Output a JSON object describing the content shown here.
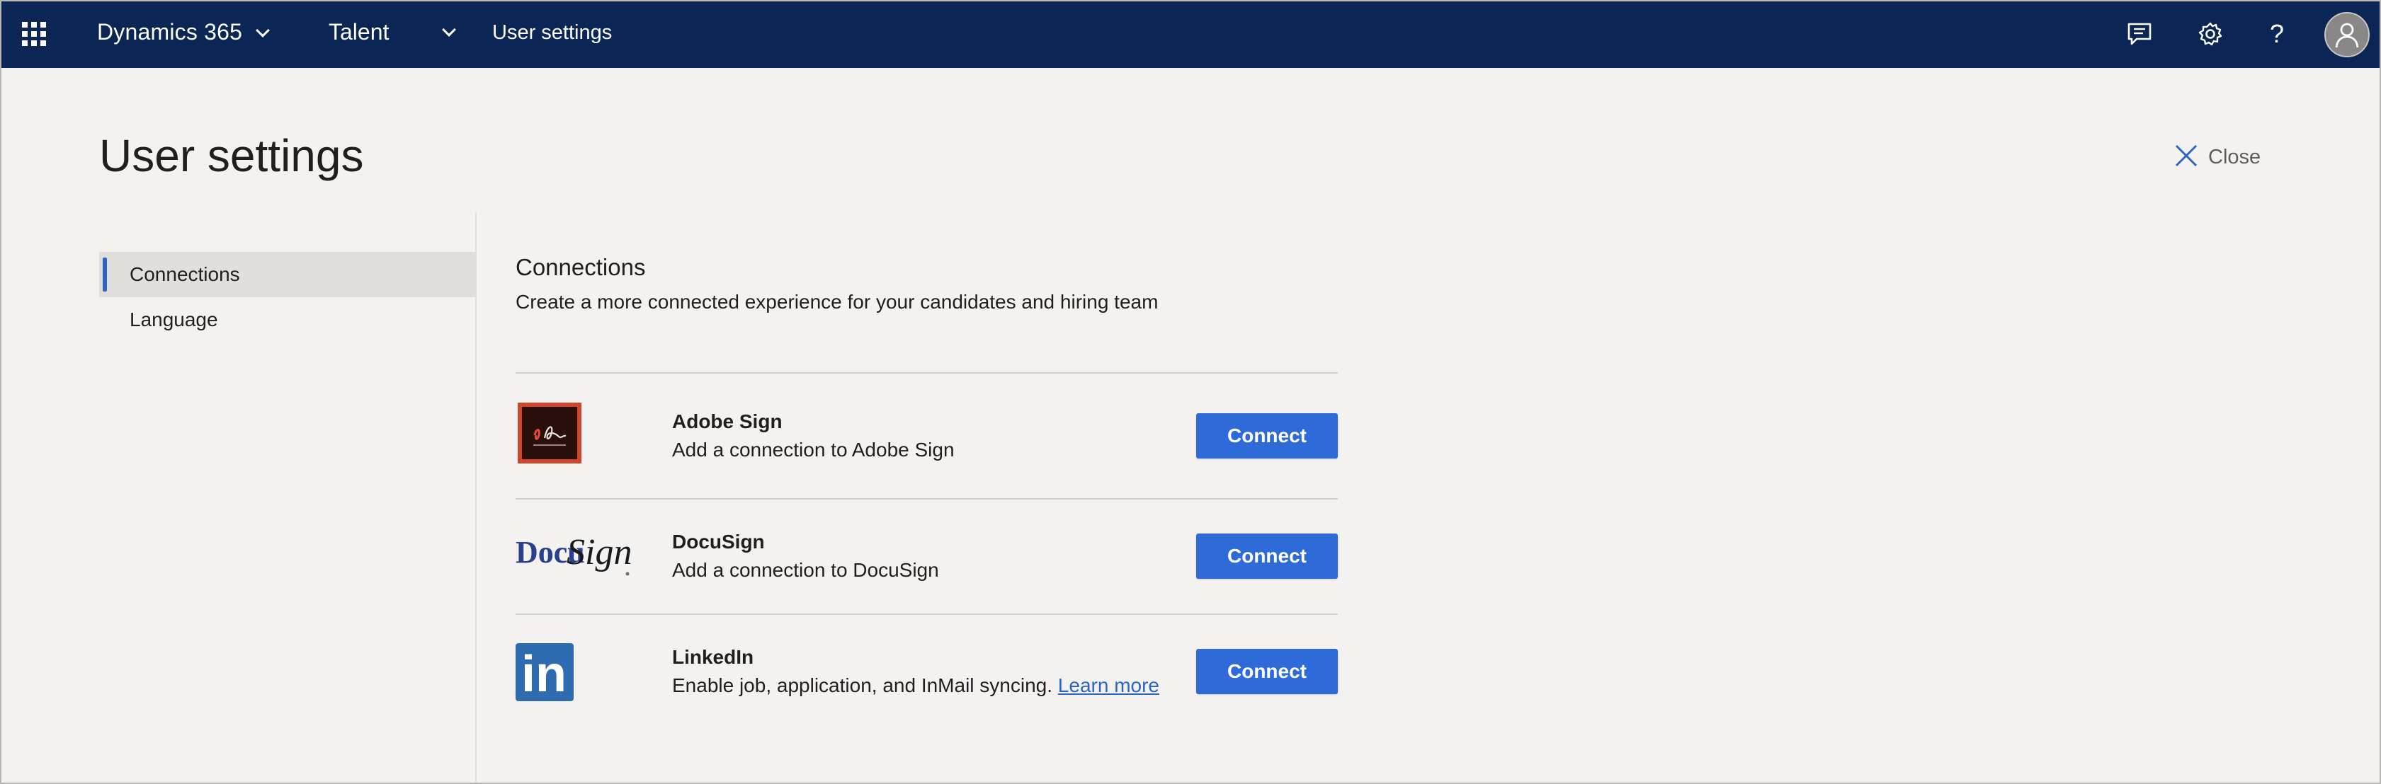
{
  "topbar": {
    "app_name": "Dynamics 365",
    "module": "Talent",
    "page": "User settings",
    "icons": [
      "waffle-icon",
      "chat-icon",
      "gear-icon",
      "help-icon",
      "avatar"
    ],
    "help_glyph": "?",
    "background": "#0b2554"
  },
  "header": {
    "title": "User settings",
    "close_label": "Close"
  },
  "sidebar": {
    "items": [
      {
        "label": "Connections",
        "active": true
      },
      {
        "label": "Language",
        "active": false
      }
    ]
  },
  "main": {
    "section_title": "Connections",
    "section_subtitle": "Create a more connected experience for your candidates and hiring team",
    "connections": [
      {
        "name": "Adobe Sign",
        "description": "Add a connection to Adobe Sign",
        "button": "Connect",
        "logo": "adobe-sign-logo"
      },
      {
        "name": "DocuSign",
        "description": "Add a connection to DocuSign",
        "button": "Connect",
        "logo": "docusign-logo",
        "logo_text_docu": "Docu",
        "logo_text_sign": "Sign"
      },
      {
        "name": "LinkedIn",
        "description": "Enable job, application, and InMail syncing.",
        "link_text": "Learn more",
        "button": "Connect",
        "logo": "linkedin-logo",
        "logo_text": "in"
      }
    ],
    "accent_color": "#2f6ad9"
  }
}
